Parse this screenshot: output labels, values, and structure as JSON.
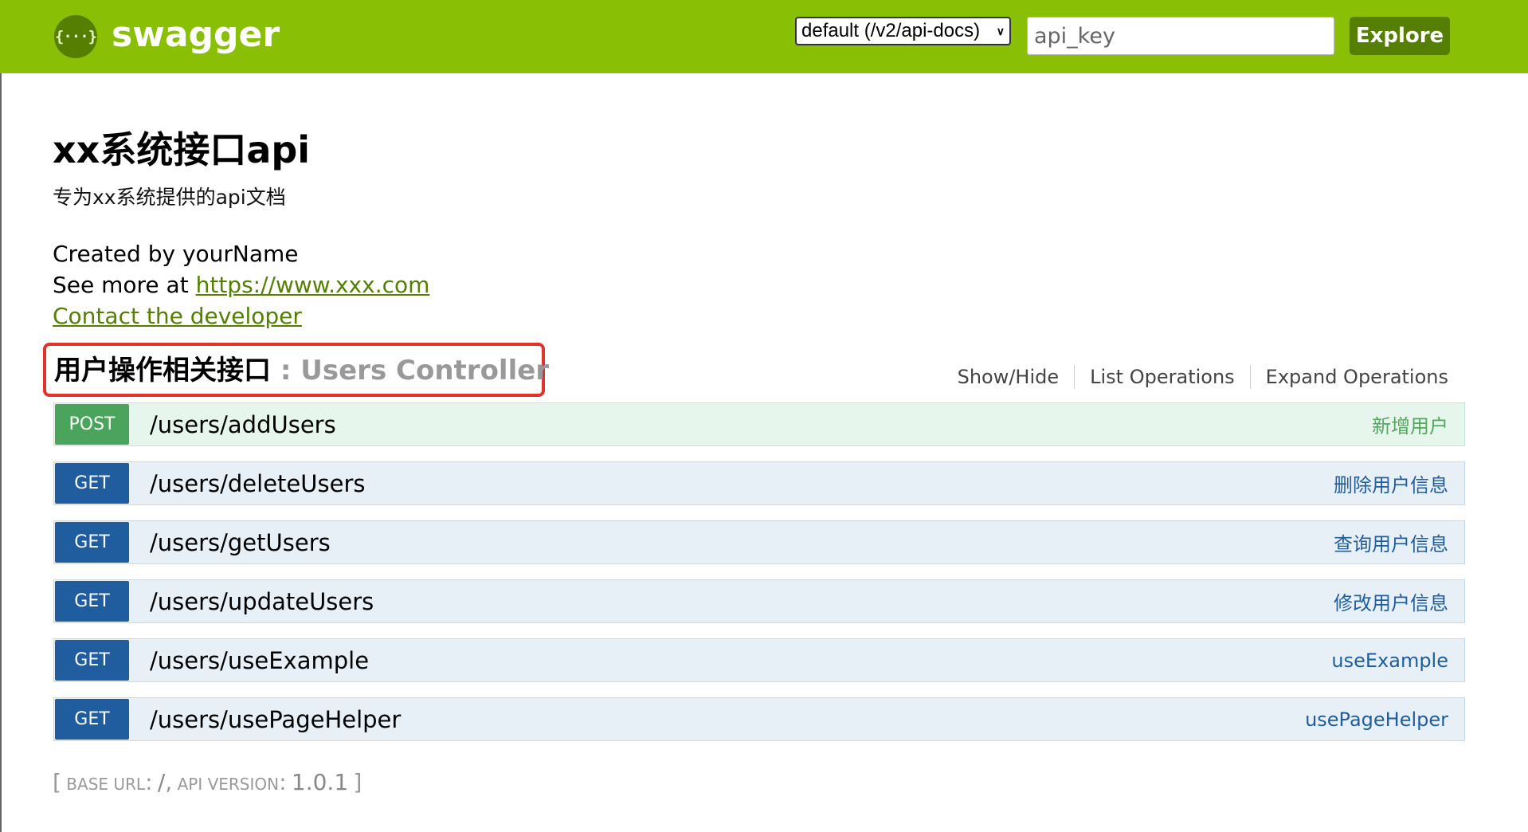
{
  "header": {
    "logo_glyph": "{···}",
    "logo_text": "swagger",
    "spec_select_value": "default (/v2/api-docs)",
    "api_key_placeholder": "api_key",
    "explore_label": "Explore",
    "bg_color": "#89bf04"
  },
  "info": {
    "title": "xx系统接口api",
    "description": "专为xx系统提供的api文档",
    "created_by": "Created by yourName",
    "see_more_prefix": "See more at ",
    "see_more_link": "https://www.xxx.com",
    "contact": "Contact the developer"
  },
  "resource": {
    "name": "用户操作相关接口",
    "separator": " : ",
    "description": "Users Controller",
    "actions": [
      "Show/Hide",
      "List Operations",
      "Expand Operations"
    ]
  },
  "operations": [
    {
      "method": "POST",
      "path": "/users/addUsers",
      "summary": "新增用户"
    },
    {
      "method": "GET",
      "path": "/users/deleteUsers",
      "summary": "删除用户信息"
    },
    {
      "method": "GET",
      "path": "/users/getUsers",
      "summary": "查询用户信息"
    },
    {
      "method": "GET",
      "path": "/users/updateUsers",
      "summary": "修改用户信息"
    },
    {
      "method": "GET",
      "path": "/users/useExample",
      "summary": "useExample"
    },
    {
      "method": "GET",
      "path": "/users/usePageHelper",
      "summary": "usePageHelper"
    }
  ],
  "footer": {
    "open_bracket": "[",
    "base_url_label": "BASE URL",
    "base_url_value": "/",
    "api_version_label": "API VERSION",
    "api_version_value": "1.0.1",
    "close_bracket": "]"
  }
}
